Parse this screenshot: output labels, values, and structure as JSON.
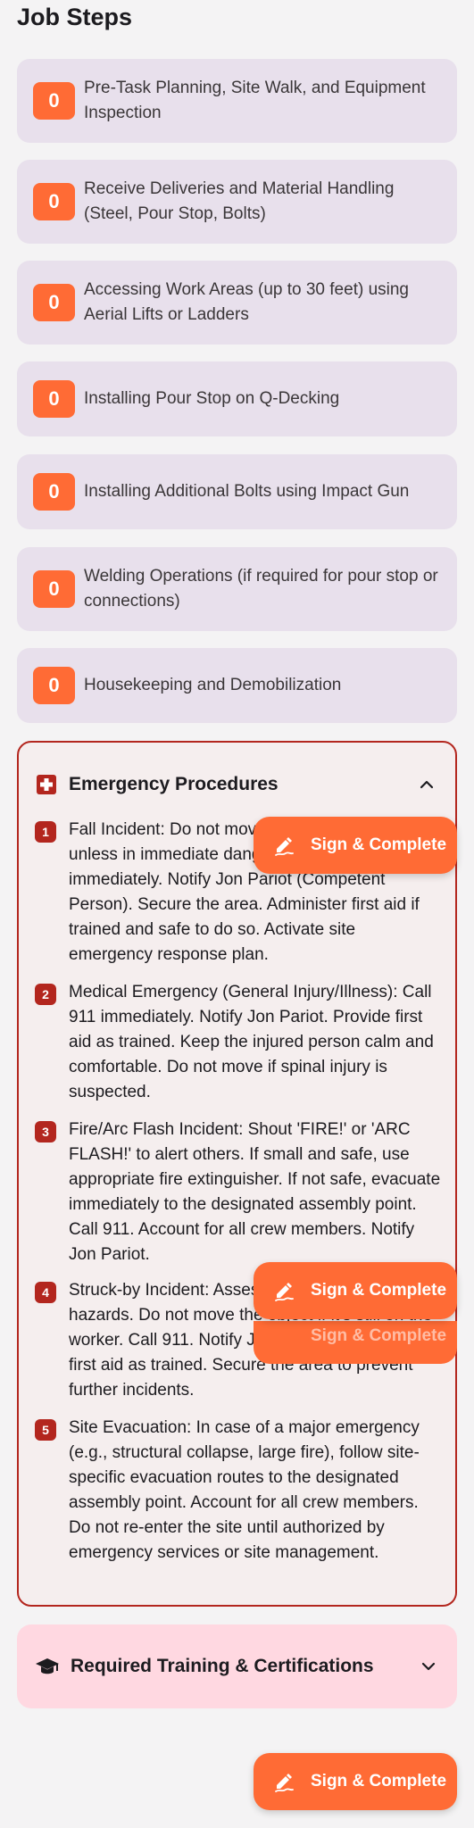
{
  "page": {
    "title": "Job Steps"
  },
  "steps": [
    {
      "count": "0",
      "label": "Pre-Task Planning, Site Walk, and Equipment Inspection"
    },
    {
      "count": "0",
      "label": "Receive Deliveries and Material Handling (Steel, Pour Stop, Bolts)"
    },
    {
      "count": "0",
      "label": "Accessing Work Areas (up to 30 feet) using Aerial Lifts or Ladders"
    },
    {
      "count": "0",
      "label": "Installing Pour Stop on Q-Decking"
    },
    {
      "count": "0",
      "label": "Installing Additional Bolts using Impact Gun"
    },
    {
      "count": "0",
      "label": "Welding Operations (if required for pour stop or connections)"
    },
    {
      "count": "0",
      "label": "Housekeeping and Demobilization"
    }
  ],
  "emergency": {
    "title": "Emergency Procedures",
    "icon": "medical-cross-icon",
    "expanded": true,
    "items": [
      {
        "num": "1",
        "text": "Fall Incident: Do not move the injured worker unless in immediate danger. Call 911 immediately. Notify Jon Pariot (Competent Person). Secure the area. Administer first aid if trained and safe to do so. Activate site emergency response plan."
      },
      {
        "num": "2",
        "text": "Medical Emergency (General Injury/Illness): Call 911 immediately. Notify Jon Pariot. Provide first aid as trained. Keep the injured person calm and comfortable. Do not move if spinal injury is suspected."
      },
      {
        "num": "3",
        "text": "Fire/Arc Flash Incident: Shout 'FIRE!' or 'ARC FLASH!' to alert others. If small and safe, use appropriate fire extinguisher. If not safe, evacuate immediately to the designated assembly point. Call 911. Account for all crew members. Notify Jon Pariot."
      },
      {
        "num": "4",
        "text": "Struck-by Incident: Assess the scene for ongoing hazards. Do not move the object if it's still on the worker. Call 911. Notify Jon Pariot. Administer first aid as trained. Secure the area to prevent further incidents."
      },
      {
        "num": "5",
        "text": "Site Evacuation: In case of a major emergency (e.g., structural collapse, large fire), follow site-specific evacuation routes to the designated assembly point. Account for all crew members. Do not re-enter the site until authorized by emergency services or site management."
      }
    ]
  },
  "training": {
    "title": "Required Training & Certifications",
    "icon": "graduation-cap-icon",
    "expanded": false
  },
  "fab": {
    "label": "Sign & Complete",
    "icon": "signature-icon",
    "color": "#ff6b35"
  },
  "colors": {
    "accent": "#ff6b35",
    "danger": "#b3261e",
    "step_card": "#e8e0ec",
    "training_card": "#ffd8e1"
  }
}
